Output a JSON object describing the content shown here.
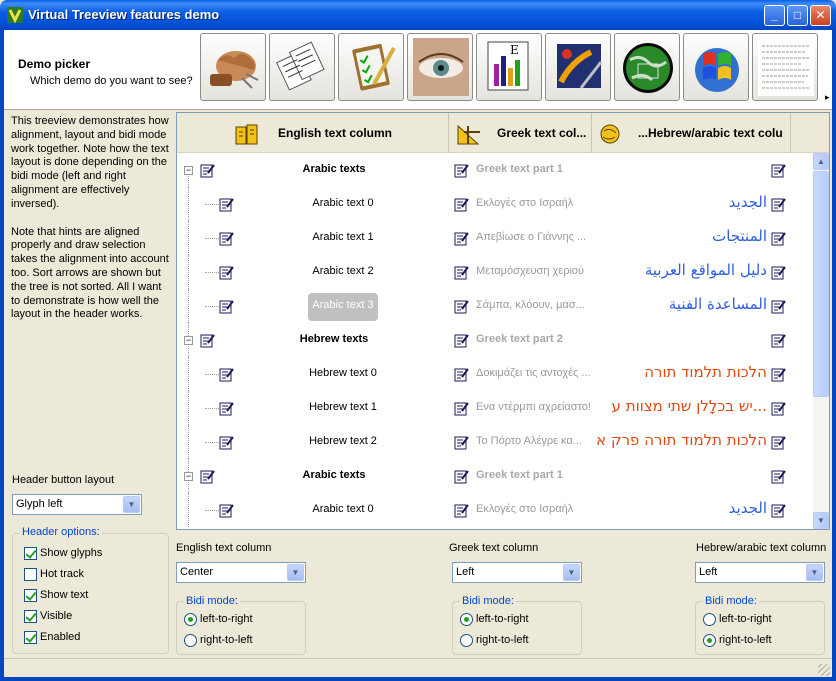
{
  "window": {
    "title": "Virtual Treeview features demo",
    "minimize_glyph": "_",
    "maximize_glyph": "□",
    "close_glyph": "✕"
  },
  "picker": {
    "title": "Demo picker",
    "subtitle": "Which demo do you want to see?",
    "more_glyph": "▸",
    "buttons": [
      "fist-icon",
      "documents-icon",
      "clipboard-icon",
      "eye-icon",
      "formula-chart-icon",
      "paint-icon",
      "globe-icon",
      "windows-logo-icon",
      "text-page-icon"
    ]
  },
  "description": {
    "para1": "This treeview demonstrates how alignment, layout and bidi mode work together. Note how the text layout is done depending on the bidi mode (left and right alignment are effectively inversed).",
    "para2": "Note that hints are aligned properly and draw selection takes the alignment into account too. Sort arrows are shown but the tree is not sorted. All I want to demonstrate is how well the layout in the header works."
  },
  "header_layout": {
    "label": "Header button layout",
    "value": "Glyph left"
  },
  "header_options": {
    "legend": "Header options:",
    "items": [
      {
        "label": "Show glyphs",
        "checked": true
      },
      {
        "label": "Hot track",
        "checked": false
      },
      {
        "label": "Show text",
        "checked": true
      },
      {
        "label": "Visible",
        "checked": true
      },
      {
        "label": "Enabled",
        "checked": true
      }
    ]
  },
  "tree": {
    "columns": [
      "English text column",
      "Greek text col...",
      "...Hebrew/arabic text colu"
    ],
    "rows": [
      {
        "level": 0,
        "en": "Arabic texts",
        "gr": "Greek text part 1",
        "rtl": "",
        "rtl_kind": "none",
        "selected": false
      },
      {
        "level": 1,
        "en": "Arabic text 0",
        "gr": "Εκλογές στο Ισραήλ",
        "rtl": "الجديد",
        "rtl_kind": "arabic",
        "selected": false
      },
      {
        "level": 1,
        "en": "Arabic text 1",
        "gr": "Απεβίωσε ο Γιάννης ...",
        "rtl": "المنتجات",
        "rtl_kind": "arabic",
        "selected": false
      },
      {
        "level": 1,
        "en": "Arabic text 2",
        "gr": "Μεταμόσχευση χεριού",
        "rtl": "دليل المواقع العربية",
        "rtl_kind": "arabic",
        "selected": false
      },
      {
        "level": 1,
        "en": "Arabic text 3",
        "gr": "Σάμπα, κλόουν, μασ...",
        "rtl": "المساعدة الفنية",
        "rtl_kind": "arabic",
        "selected": true
      },
      {
        "level": 0,
        "en": "Hebrew texts",
        "gr": "Greek text part 2",
        "rtl": "",
        "rtl_kind": "none",
        "selected": false
      },
      {
        "level": 1,
        "en": "Hebrew text 0",
        "gr": "Δοκιμάζει τις αντοχές ...",
        "rtl": "הלכות תלמוד תורה",
        "rtl_kind": "hebrew",
        "selected": false
      },
      {
        "level": 1,
        "en": "Hebrew text 1",
        "gr": "Ενα ντέρμπι αχρείαστο!",
        "rtl": "...יש בכלָלן שתי מצוות ע",
        "rtl_kind": "hebrew",
        "selected": false
      },
      {
        "level": 1,
        "en": "Hebrew text 2",
        "gr": "Το Πόρτο Αλέγρε κα...",
        "rtl": "הלכות תלמוד תורה פרק א",
        "rtl_kind": "hebrew",
        "selected": false
      },
      {
        "level": 0,
        "en": "Arabic texts",
        "gr": "Greek text part 1",
        "rtl": "",
        "rtl_kind": "none",
        "selected": false
      },
      {
        "level": 1,
        "en": "Arabic text 0",
        "gr": "Εκλογές στο Ισραήλ",
        "rtl": "الجديد",
        "rtl_kind": "arabic",
        "selected": false
      }
    ],
    "expander_glyph": "−",
    "scroll_up": "▲",
    "scroll_down": "▼"
  },
  "column_settings": [
    {
      "label": "English text column",
      "alignment": "Center",
      "bidi_legend": "Bidi mode:",
      "ltr": "left-to-right",
      "rtl": "right-to-left",
      "mode": "ltr"
    },
    {
      "label": "Greek text column",
      "alignment": "Left",
      "bidi_legend": "Bidi mode:",
      "ltr": "left-to-right",
      "rtl": "right-to-left",
      "mode": "ltr"
    },
    {
      "label": "Hebrew/arabic text column",
      "alignment": "Left",
      "bidi_legend": "Bidi mode:",
      "ltr": "left-to-right",
      "rtl": "right-to-left",
      "mode": "rtl"
    }
  ],
  "combo_arrow": "▼",
  "colors": {
    "titlebar": "#0352d8",
    "arabic_text": "#3060e0",
    "hebrew_text": "#e04a10",
    "greek_text": "#9a9a9a",
    "selection": "#c0c0c0"
  }
}
